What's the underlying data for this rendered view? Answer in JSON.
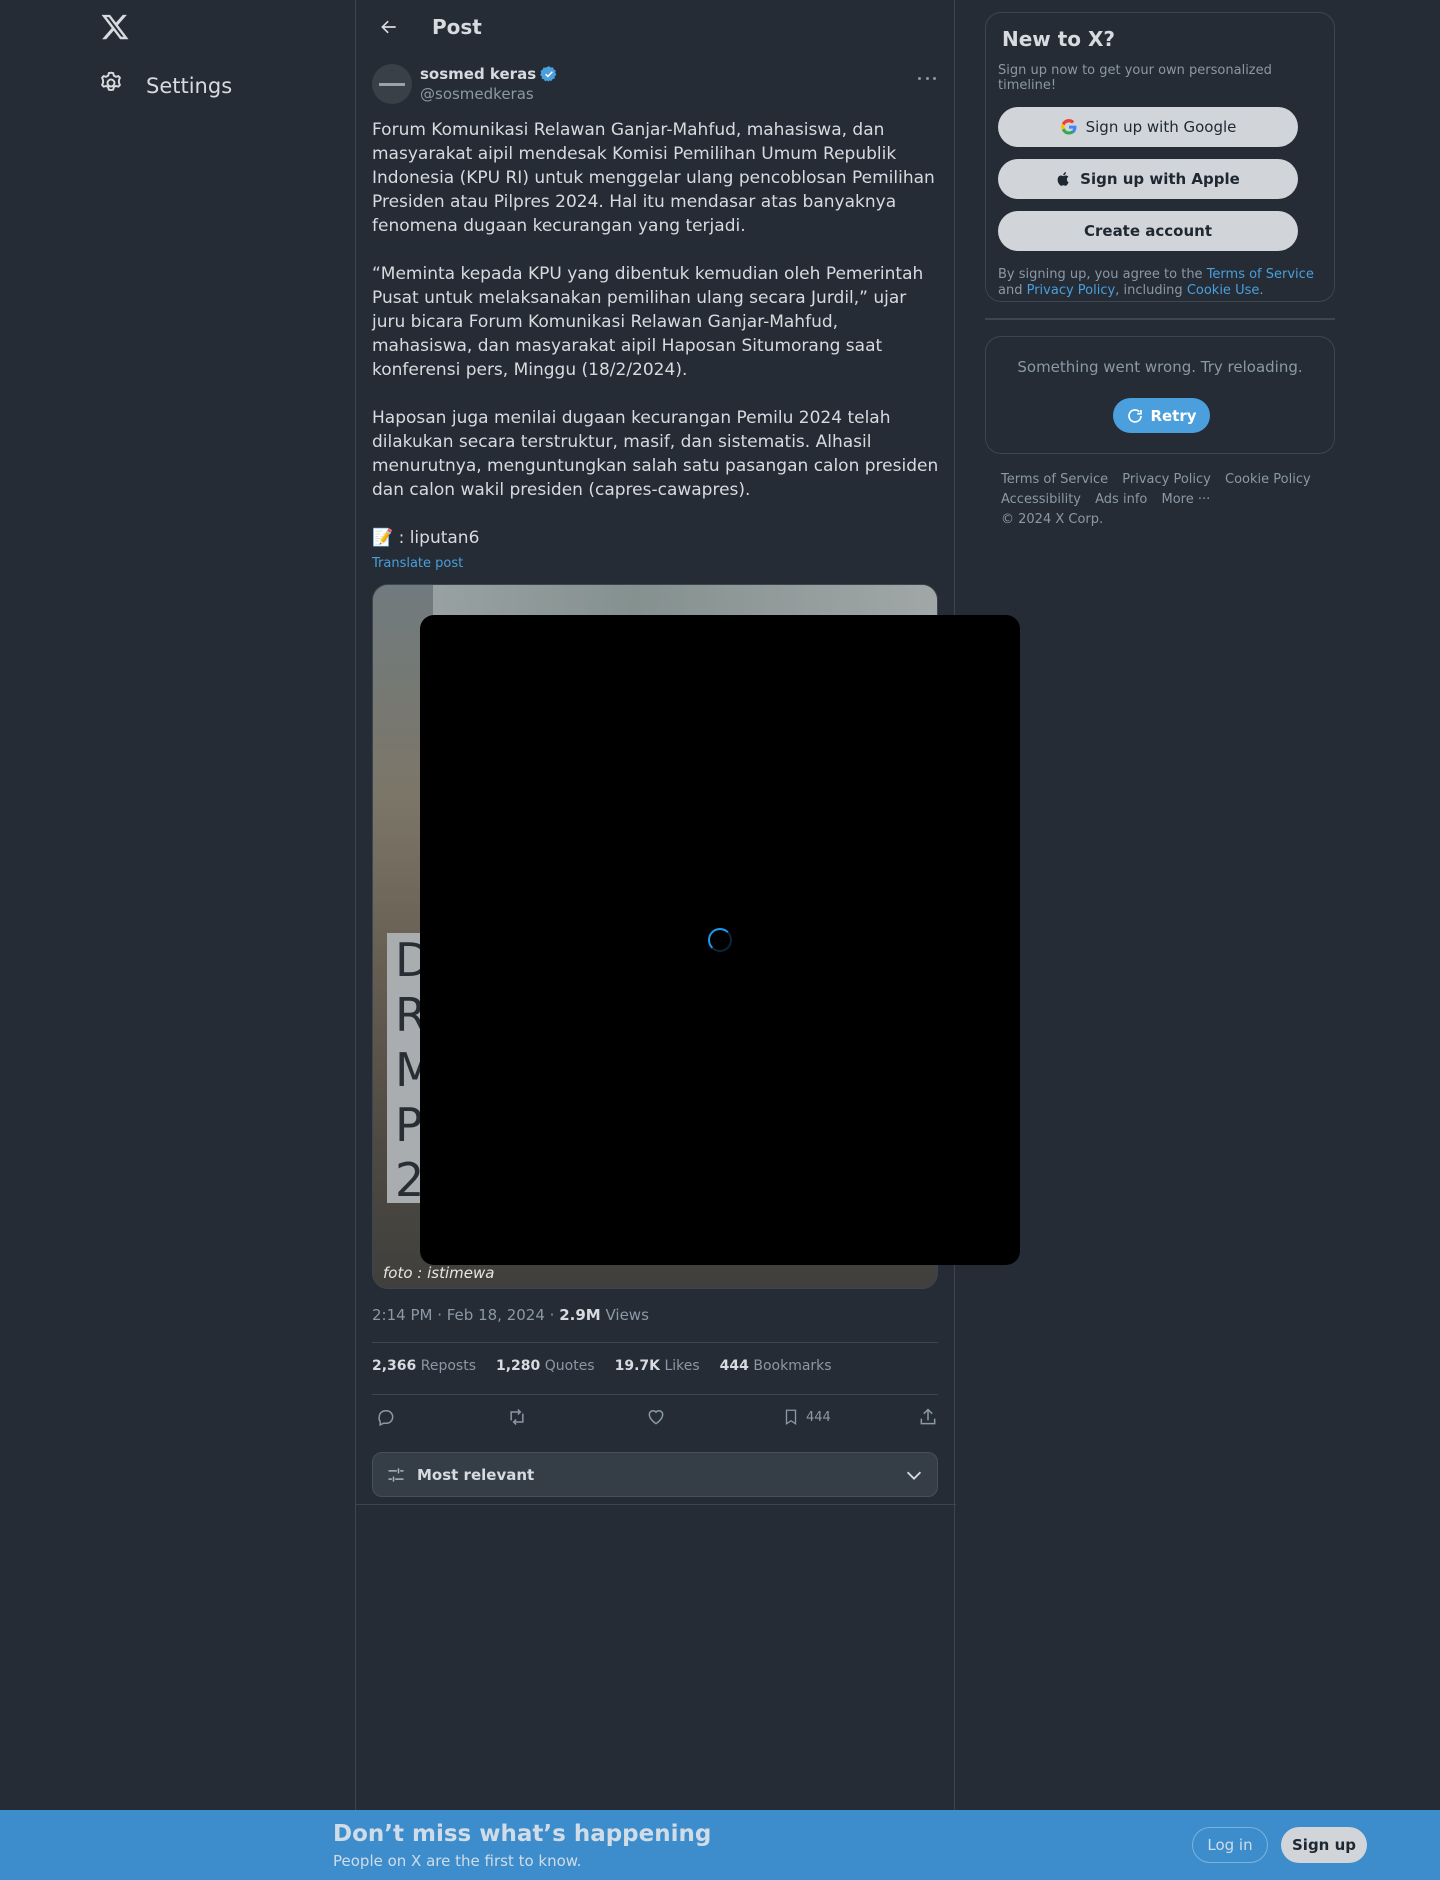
{
  "nav": {
    "logo_name": "x-logo",
    "settings_label": "Settings"
  },
  "header": {
    "title": "Post"
  },
  "post": {
    "author_name": "sosmed keras",
    "author_handle": "@sosmedkeras",
    "paragraphs": [
      "Forum Komunikasi Relawan Ganjar-Mahfud, mahasiswa, dan masyarakat aipil mendesak Komisi Pemilihan Umum Republik Indonesia (KPU RI) untuk menggelar ulang pencoblosan Pemilihan Presiden atau Pilpres 2024. Hal itu mendasar atas banyaknya fenomena dugaan kecurangan yang terjadi.",
      "“Meminta kepada KPU yang dibentuk kemudian oleh Pemerintah Pusat untuk melaksanakan pemilihan ulang secara Jurdil,” ujar juru bicara Forum Komunikasi Relawan Ganjar-Mahfud, mahasiswa, dan masyarakat aipil Haposan Situmorang saat konferensi pers, Minggu (18/2/2024).",
      "Haposan juga menilai dugaan kecurangan Pemilu 2024 telah dilakukan secara terstruktur, masif, dan sistematis. Alhasil menurutnya, menguntungkan salah satu pasangan calon presiden dan calon wakil presiden (capres-cawapres).",
      "📝 : liputan6"
    ],
    "translate_label": "Translate post",
    "media_caption_letters": [
      "D",
      "R",
      "M",
      "P",
      "2"
    ],
    "media_credit": "foto : istimewa",
    "time": "2:14 PM · Feb 18, 2024",
    "views_count": "2.9M",
    "views_label": "Views"
  },
  "stats": {
    "reposts_count": "2,366",
    "reposts_label": "Reposts",
    "quotes_count": "1,280",
    "quotes_label": "Quotes",
    "likes_count": "19.7K",
    "likes_label": "Likes",
    "bookmarks_count": "444",
    "bookmarks_label": "Bookmarks"
  },
  "actions": {
    "bookmark_count": "444"
  },
  "sort": {
    "label": "Most relevant"
  },
  "signup_card": {
    "title": "New to X?",
    "subtitle": "Sign up now to get your own personalized timeline!",
    "google_label": "Sign up with Google",
    "apple_label": "Sign up with Apple",
    "create_label": "Create account",
    "terms_prefix": "By signing up, you agree to the ",
    "terms_link": "Terms of Service",
    "terms_and": " and ",
    "privacy_link": "Privacy Policy",
    "terms_including": ", including ",
    "cookie_link": "Cookie Use",
    "terms_end": "."
  },
  "error_card": {
    "message": "Something went wrong. Try reloading.",
    "retry_label": "Retry"
  },
  "footer": {
    "links": [
      "Terms of Service",
      "Privacy Policy",
      "Cookie Policy",
      "Accessibility",
      "Ads info",
      "More ···"
    ],
    "copyright": "© 2024 X Corp."
  },
  "bottom_bar": {
    "title": "Don’t miss what’s happening",
    "subtitle": "People on X are the first to know.",
    "login_label": "Log in",
    "signup_label": "Sign up"
  },
  "colors": {
    "background": "#252c35",
    "accent": "#4a9fdc",
    "bottom_bar": "#3d8ccc",
    "verified": "#4a9fdc"
  }
}
